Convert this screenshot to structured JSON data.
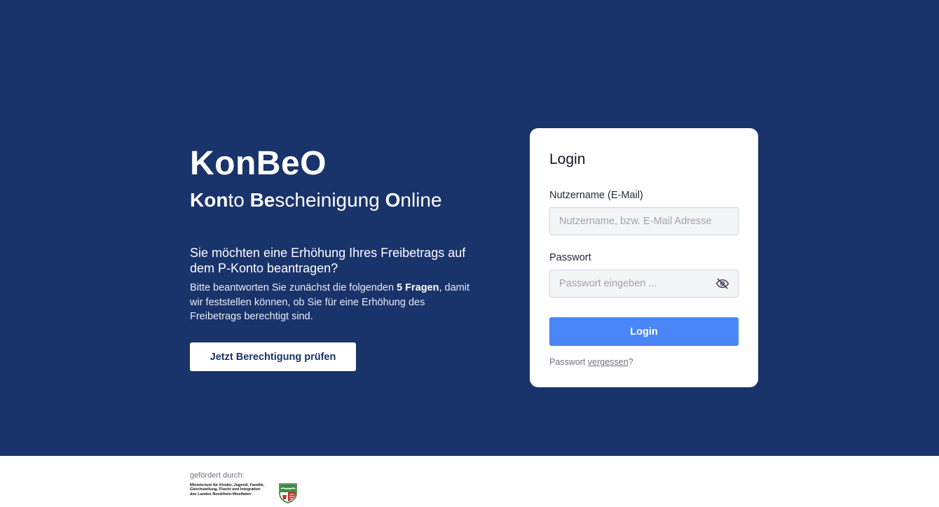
{
  "hero": {
    "title": "KonBeO",
    "subtitle": [
      {
        "bold": "Kon",
        "rest": "to "
      },
      {
        "bold": "Be",
        "rest": "scheinigung "
      },
      {
        "bold": "O",
        "rest": "nline"
      }
    ],
    "question": "Sie möchten eine Erhöhung Ihres Freibetrags auf dem P-Konto beantragen?",
    "explain_before": "Bitte beantworten Sie zunächst die folgenden ",
    "explain_bold": "5 Fragen",
    "explain_after": ", damit wir feststellen können, ob Sie für eine Erhöhung des Freibetrags berechtigt sind.",
    "cta_label": "Jetzt Berechtigung prüfen"
  },
  "login": {
    "title": "Login",
    "username_label": "Nutzername (E-Mail)",
    "username_placeholder": "Nutzername, bzw. E-Mail Adresse",
    "password_label": "Passwort",
    "password_placeholder": "Passwort eingeben ...",
    "password_toggle_icon": "eye-off-icon",
    "submit_label": "Login",
    "forgot_before": "Passwort ",
    "forgot_link": "vergessen",
    "forgot_after": "?"
  },
  "footer": {
    "funded_by": "gefördert durch:",
    "ministry_lines": [
      "Ministerium für Kinder, Jugend, Familie,",
      "Gleichstellung, Flucht und Integration",
      "des Landes Nordrhein-Westfalen"
    ],
    "crest_icon": "nrw-coat-of-arms-icon"
  },
  "colors": {
    "hero_bg": "#19336b",
    "primary_button": "#4a86f7",
    "card_bg": "#ffffff"
  }
}
